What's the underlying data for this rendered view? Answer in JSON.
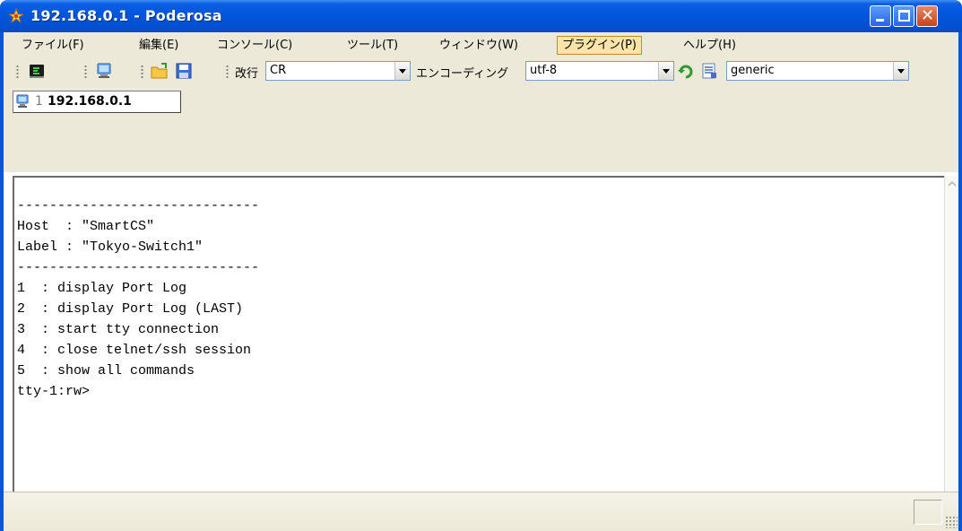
{
  "window": {
    "title": "192.168.0.1 - Poderosa",
    "icon": "poderosa-app-icon"
  },
  "menu": {
    "items": [
      {
        "label": "ファイル(F)"
      },
      {
        "label": "編集(E)"
      },
      {
        "label": "コンソール(C)"
      },
      {
        "label": "ツール(T)"
      },
      {
        "label": "ウィンドウ(W)"
      },
      {
        "label": "プラグイン(P)",
        "active": true
      },
      {
        "label": "ヘルプ(H)"
      }
    ]
  },
  "toolbar": {
    "newline_label": "改行",
    "newline_value": "CR",
    "encoding_label": "エンコーディング",
    "encoding_value": "utf-8",
    "terminal_type_value": "generic",
    "icons": [
      "new-connection-icon",
      "terminal-icon",
      "open-folder-icon",
      "save-icon",
      "reconnect-icon",
      "properties-icon"
    ]
  },
  "tab": {
    "number": "1",
    "label": "192.168.0.1"
  },
  "terminal": {
    "lines": [
      "------------------------------",
      "Host  : \"SmartCS\"",
      "Label : \"Tokyo-Switch1\"",
      "------------------------------",
      "1  : display Port Log",
      "2  : display Port Log (LAST)",
      "3  : start tty connection",
      "4  : close telnet/ssh session",
      "5  : show all commands",
      "tty-1:rw>"
    ]
  },
  "colors": {
    "titlebar": "#0256dc",
    "menubar": "#ece9d8",
    "active_menu": "#fce4a7",
    "terminal_bg": "#ffffff"
  }
}
